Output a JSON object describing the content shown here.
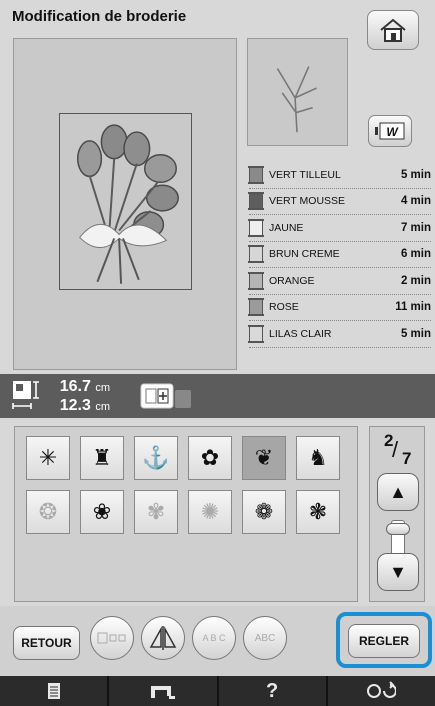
{
  "header": {
    "title": "Modification de broderie",
    "home_icon": "home-icon"
  },
  "stitch_button": {
    "label": "W",
    "icon": "stitch-preview-icon"
  },
  "colors": [
    {
      "name": "VERT TILLEUL",
      "time": "5 min",
      "color": "#8a8a8a"
    },
    {
      "name": "VERT MOUSSE",
      "time": "4 min",
      "color": "#5e5e5e"
    },
    {
      "name": "JAUNE",
      "time": "7 min",
      "color": "#eeeeee"
    },
    {
      "name": "BRUN CREME",
      "time": "6 min",
      "color": "#d6d6d6"
    },
    {
      "name": "ORANGE",
      "time": "2 min",
      "color": "#b5b5b5"
    },
    {
      "name": "ROSE",
      "time": "11 min",
      "color": "#9b9b9b"
    },
    {
      "name": "LILAS CLAIR",
      "time": "5 min",
      "color": "#d9d9d9"
    }
  ],
  "size": {
    "height_value": "16.7",
    "width_value": "12.3",
    "unit": "cm"
  },
  "pagination": {
    "current": "2",
    "total": "7"
  },
  "patterns": {
    "row1": [
      "✳",
      "♜",
      "⚓",
      "✿",
      "❦",
      "♞"
    ],
    "row2": [
      "❂",
      "❀",
      "✾",
      "✺",
      "❁",
      "❃"
    ]
  },
  "actions": {
    "retour": "RETOUR",
    "regler": "REGLER",
    "text_arc_label": "A B C",
    "text_check_label": "ABC"
  },
  "bottom_bar": {
    "help_label": "?"
  }
}
